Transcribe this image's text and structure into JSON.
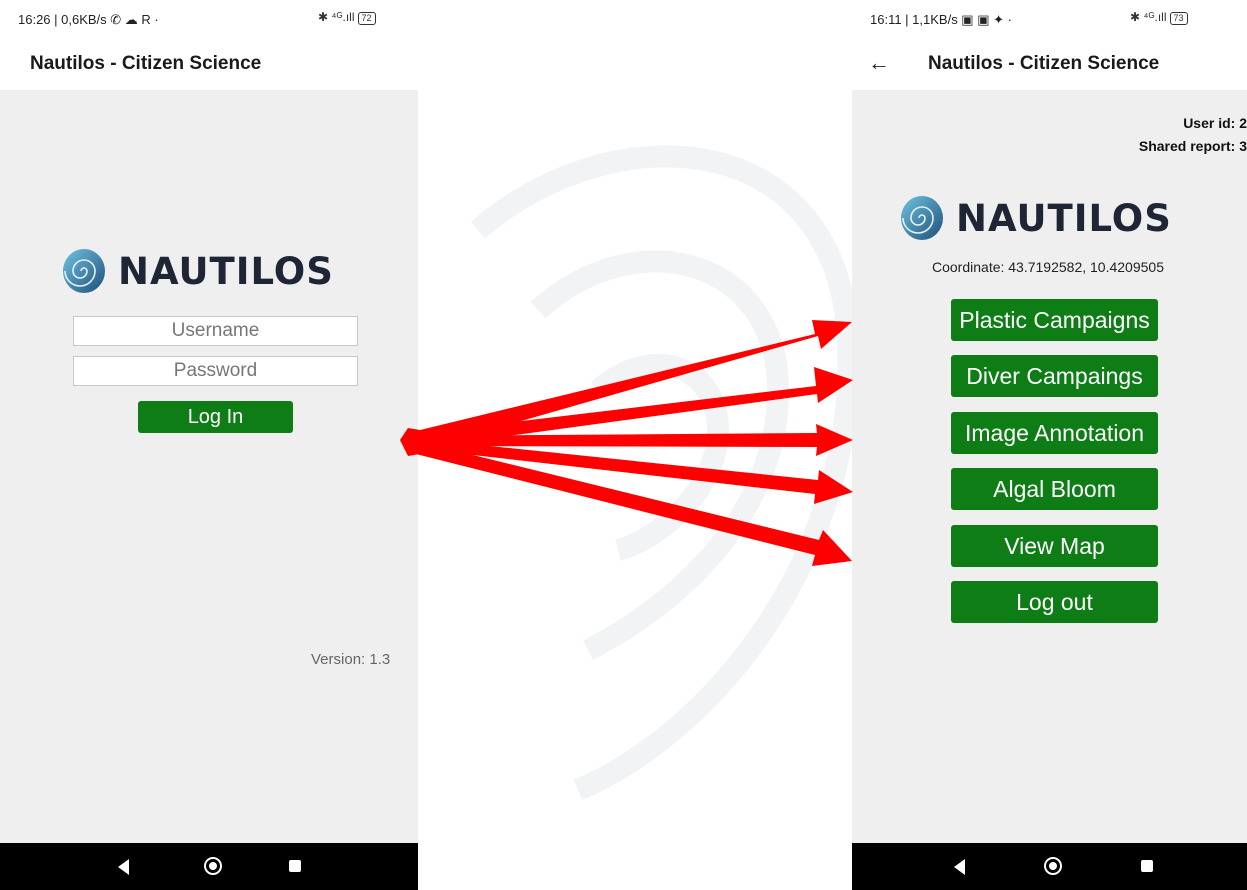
{
  "left_screen": {
    "status": {
      "time": "16:26 | 0,6KB/s ✆ ☁ R ·",
      "right": "✱ ⁴ᴳ.ıll",
      "battery": "72"
    },
    "appbar": {
      "title": "Nautilos - Citizen Science"
    },
    "brand": "NAUTILOS",
    "username_placeholder": "Username",
    "password_placeholder": "Password",
    "login_label": "Log In",
    "version": "Version: 1.3"
  },
  "right_screen": {
    "status": {
      "time": "16:11 | 1,1KB/s ▣ ▣ ✦ ·",
      "right": "✱ ⁴ᴳ.ıll",
      "battery": "73"
    },
    "appbar": {
      "title": "Nautilos - Citizen Science",
      "back_icon": "←"
    },
    "user_id": "User id: 2",
    "shared_report": "Shared report: 3",
    "brand": "NAUTILOS",
    "coordinate": "Coordinate: 43.7192582, 10.4209505",
    "menu": [
      {
        "label": "Plastic Campaigns"
      },
      {
        "label": "Diver Campaings"
      },
      {
        "label": "Image Annotation"
      },
      {
        "label": "Algal Bloom"
      },
      {
        "label": "View Map"
      },
      {
        "label": "Log out"
      }
    ]
  },
  "colors": {
    "button_green": "#0e7d16",
    "arrow_red": "#ff0000",
    "background": "#efefef"
  },
  "icons": [
    "nautilus-logo-icon",
    "back-arrow-icon",
    "nav-back-icon",
    "nav-home-icon",
    "nav-recent-icon"
  ]
}
